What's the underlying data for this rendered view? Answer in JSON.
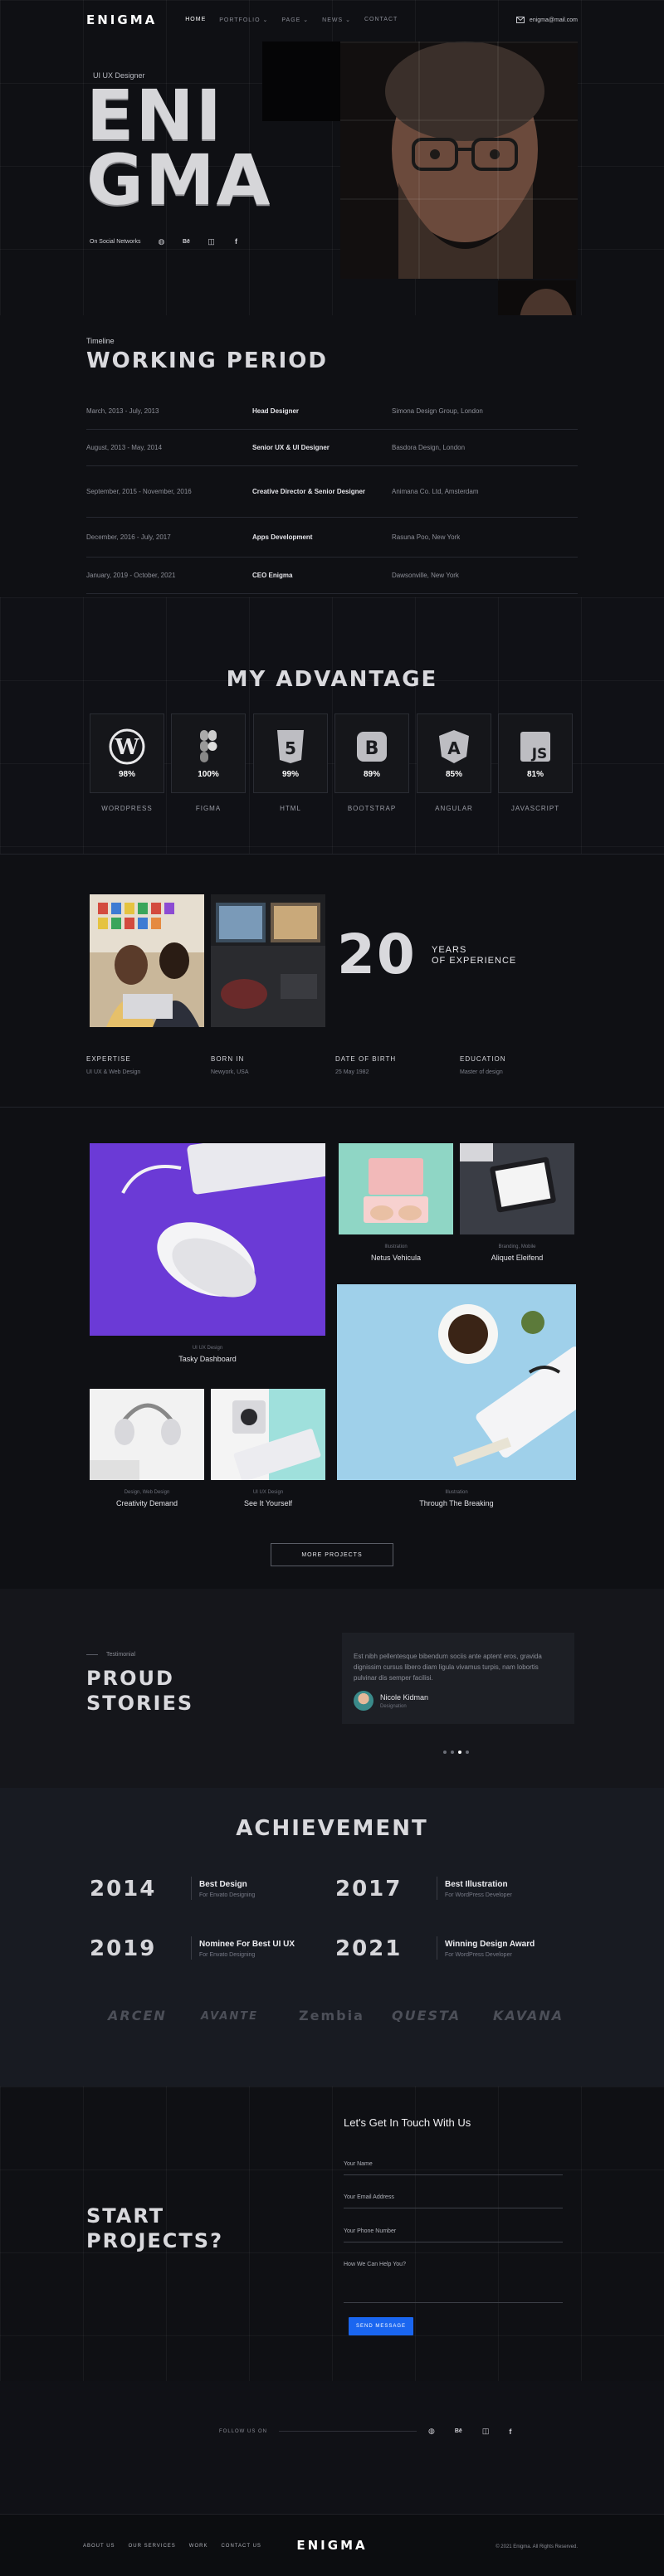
{
  "header": {
    "logo": "ENIGMA",
    "menu": [
      "HOME",
      "PORTFOLIO",
      "PAGE",
      "NEWS",
      "CONTACT"
    ],
    "email": "enigma@mail.com"
  },
  "hero": {
    "role": "UI UX Designer",
    "name_line1": "ENI",
    "name_line2": "GMA",
    "social_label": "On Social Networks",
    "social_icons": [
      "dribbble-icon",
      "behance-icon",
      "instagram-icon",
      "facebook-icon"
    ]
  },
  "timeline": {
    "eyebrow": "Timeline",
    "title": "WORKING PERIOD",
    "rows": [
      {
        "period": "March, 2013 - July, 2013",
        "role": "Head Designer",
        "company": "Simona Design Group, London"
      },
      {
        "period": "August, 2013 - May, 2014",
        "role": "Senior UX & UI Designer",
        "company": "Basdora Design, London"
      },
      {
        "period": "September, 2015 - November, 2016",
        "role": "Creative Director & Senior Designer",
        "company": "Animana Co. Ltd, Amsterdam"
      },
      {
        "period": "December, 2016 - July, 2017",
        "role": "Apps Development",
        "company": "Rasuna Poo, New York"
      },
      {
        "period": "January, 2019 - October, 2021",
        "role": "CEO Enigma",
        "company": "Dawsonville, New York"
      }
    ]
  },
  "advantage": {
    "title": "MY ADVANTAGE",
    "items": [
      {
        "label": "WORDPRESS",
        "pct": "98%",
        "icon": "wordpress-icon"
      },
      {
        "label": "FIGMA",
        "pct": "100%",
        "icon": "figma-icon"
      },
      {
        "label": "HTML",
        "pct": "99%",
        "icon": "html5-icon"
      },
      {
        "label": "BOOTSTRAP",
        "pct": "89%",
        "icon": "bootstrap-icon"
      },
      {
        "label": "ANGULAR",
        "pct": "85%",
        "icon": "angular-icon"
      },
      {
        "label": "JAVASCRIPT",
        "pct": "81%",
        "icon": "javascript-icon"
      }
    ]
  },
  "experience": {
    "years": "20",
    "line1": "YEARS",
    "line2": "OF EXPERIENCE",
    "info": [
      {
        "title": "EXPERTISE",
        "value": "UI UX & Web Design"
      },
      {
        "title": "BORN IN",
        "value": "Newyork, USA"
      },
      {
        "title": "DATE OF BIRTH",
        "value": "25 May 1982"
      },
      {
        "title": "EDUCATION",
        "value": "Master of design"
      }
    ]
  },
  "portfolio": {
    "items": [
      {
        "cat": "UI UX Design",
        "name": "Tasky Dashboard"
      },
      {
        "cat": "Illustration",
        "name": "Netus Vehicula"
      },
      {
        "cat": "Branding, Mobile",
        "name": "Aliquet Eleifend"
      },
      {
        "cat": "Design, Web Design",
        "name": "Creativity Demand"
      },
      {
        "cat": "UI UX Design",
        "name": "See It Yourself"
      },
      {
        "cat": "Illustration",
        "name": "Through The Breaking"
      }
    ],
    "more_label": "MORE PROJECTS"
  },
  "testimonial": {
    "eyebrow": "Testimonial",
    "title_line1": "PROUD",
    "title_line2": "STORIES",
    "quote": "Est nibh pellentesque bibendum sociis ante aptent eros, gravida dignissim cursus libero diam ligula vivamus turpis, nam lobortis pulvinar dis semper facilisi.",
    "author": "Nicole Kidman",
    "author_role": "Designation"
  },
  "achievement": {
    "title": "ACHIEVEMENT",
    "items": [
      {
        "year": "2014",
        "title": "Best Design",
        "sub": "For Envato Designing"
      },
      {
        "year": "2017",
        "title": "Best Illustration",
        "sub": "For WordPress Developer"
      },
      {
        "year": "2019",
        "title": "Nominee For Best UI UX",
        "sub": "For Envato Designing"
      },
      {
        "year": "2021",
        "title": "Winning Design Award",
        "sub": "For WordPress Developer"
      }
    ],
    "brands": [
      "ARCEN",
      "AVANTE",
      "Zembia",
      "QUESTA",
      "KAVANA"
    ]
  },
  "contact": {
    "title_line1": "START",
    "title_line2": "PROJECTS?",
    "heading": "Let's Get In Touch With Us",
    "fields": [
      "Your Name",
      "Your Email Address",
      "Your Phone Number",
      "How We Can Help You?"
    ],
    "send": "SEND MESSAGE",
    "follow": "FOLLOW US ON"
  },
  "footer": {
    "nav": [
      "ABOUT US",
      "OUR SERVICES",
      "WORK",
      "CONTACT US"
    ],
    "logo": "ENIGMA",
    "copyright": "© 2021 Enigma. All Rights Reserved."
  },
  "colors": {
    "accent": "#1a66f0",
    "bg": "#0f1014",
    "panel": "#15161a"
  }
}
